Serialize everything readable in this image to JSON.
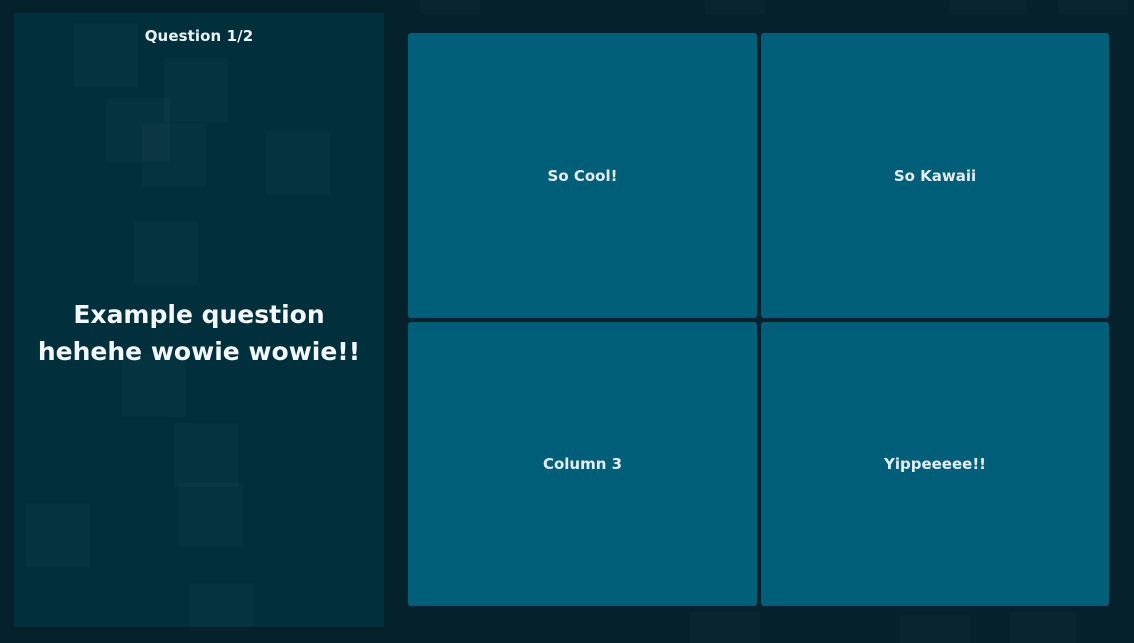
{
  "question": {
    "counter": "Question 1/2",
    "text": "Example question hehehe wowie wowie!!"
  },
  "answers": [
    {
      "label": "So Cool!"
    },
    {
      "label": "So Kawaii"
    },
    {
      "label": "Column 3"
    },
    {
      "label": "Yippeeeee!!"
    }
  ],
  "colors": {
    "background": "#05222c",
    "panel": "#012f3c",
    "answer_tile": "#015e78",
    "text": "#e1edf2"
  }
}
